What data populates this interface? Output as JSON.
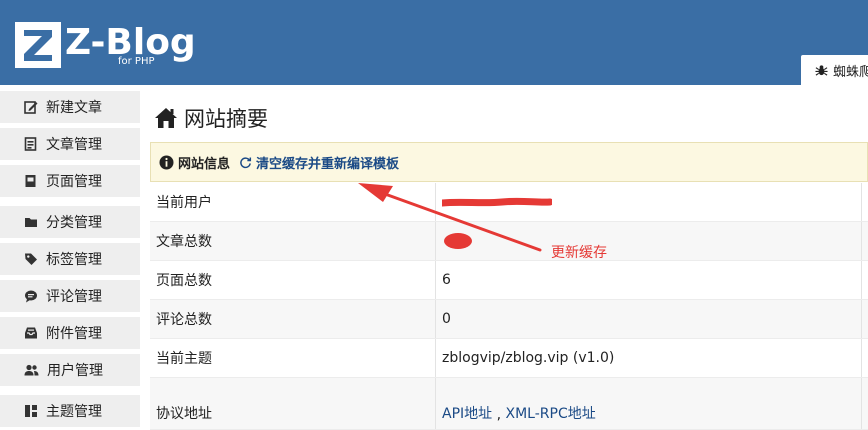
{
  "header": {
    "logo_text": "Z-Blog",
    "logo_sub": "for PHP",
    "tab_label": "蜘蛛爬"
  },
  "sidebar": {
    "items": [
      {
        "label": "新建文章",
        "icon": "edit-icon"
      },
      {
        "label": "文章管理",
        "icon": "article-list-icon"
      },
      {
        "label": "页面管理",
        "icon": "page-icon"
      },
      {
        "label": "分类管理",
        "icon": "folder-icon"
      },
      {
        "label": "标签管理",
        "icon": "tag-icon"
      },
      {
        "label": "评论管理",
        "icon": "comment-icon"
      },
      {
        "label": "附件管理",
        "icon": "inbox-icon"
      },
      {
        "label": "用户管理",
        "icon": "users-icon"
      },
      {
        "label": "主题管理",
        "icon": "grid-icon"
      }
    ]
  },
  "main": {
    "title": "网站摘要",
    "info_bar": {
      "label": "网站信息",
      "action": "清空缓存并重新编译模板"
    },
    "rows": [
      {
        "label": "当前用户",
        "value": ""
      },
      {
        "label": "文章总数",
        "value": ""
      },
      {
        "label": "页面总数",
        "value": "6"
      },
      {
        "label": "评论总数",
        "value": "0"
      },
      {
        "label": "当前主题",
        "value": "zblogvip/zblog.vip (v1.0)"
      },
      {
        "label": "协议地址",
        "value_links": [
          "API地址",
          "XML-RPC地址"
        ],
        "separator": " , "
      }
    ]
  },
  "annotation": {
    "text": "更新缓存",
    "color": "#e53935"
  },
  "colors": {
    "header_bg": "#3a6ea5",
    "sidebar_item_bg": "#eeeeee",
    "info_bar_bg": "#fcf8e1",
    "link": "#1b4a86"
  }
}
